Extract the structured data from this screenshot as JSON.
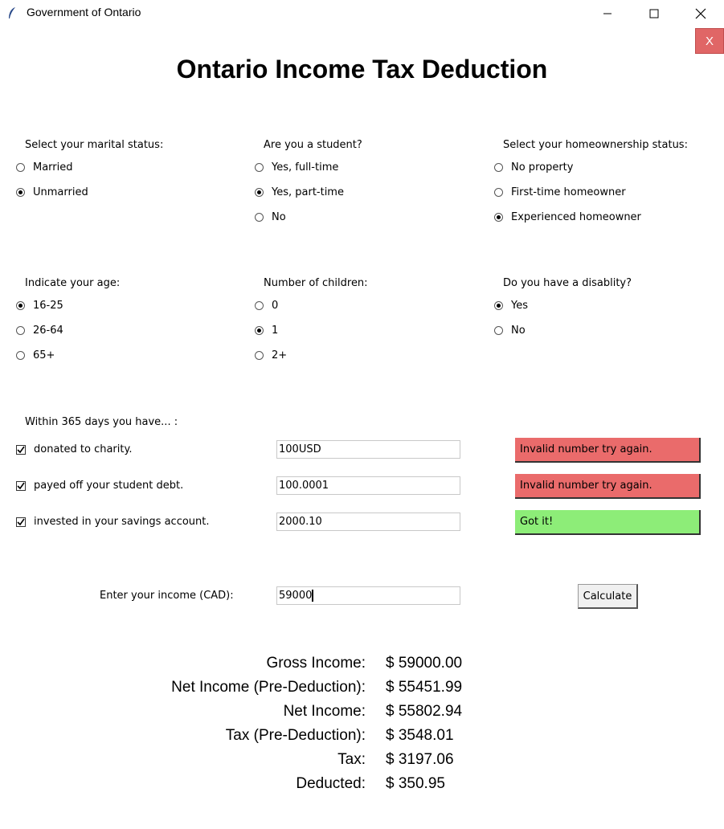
{
  "window": {
    "title": "Government of Ontario"
  },
  "close_button": "X",
  "main_title": "Ontario Income Tax Deduction",
  "marital": {
    "label": "Select your marital status:",
    "options": [
      "Married",
      "Unmarried"
    ],
    "selected": 1
  },
  "student": {
    "label": "Are you a student?",
    "options": [
      "Yes, full-time",
      "Yes, part-time",
      "No"
    ],
    "selected": 1
  },
  "home": {
    "label": "Select your homeownership status:",
    "options": [
      "No property",
      "First-time homeowner",
      "Experienced homeowner"
    ],
    "selected": 2
  },
  "age": {
    "label": "Indicate your age:",
    "options": [
      "16-25",
      "26-64",
      "65+"
    ],
    "selected": 0
  },
  "children": {
    "label": "Number of children:",
    "options": [
      "0",
      "1",
      "2+"
    ],
    "selected": 1
  },
  "disability": {
    "label": "Do you have a disablity?",
    "options": [
      "Yes",
      "No"
    ],
    "selected": 0
  },
  "within": {
    "label": "Within 365 days you have... :",
    "items": [
      {
        "label": "donated to charity.",
        "checked": true,
        "value": "100USD",
        "status": "Invalid number try again."
      },
      {
        "label": "payed off your student debt.",
        "checked": true,
        "value": "100.0001",
        "status": "Invalid number try again."
      },
      {
        "label": "invested in your savings account.",
        "checked": true,
        "value": "2000.10",
        "status": "Got it!"
      }
    ]
  },
  "income": {
    "label": "Enter your income (CAD):",
    "value": "59000"
  },
  "calculate_label": "Calculate",
  "results": [
    {
      "label": "Gross Income:",
      "value": "$ 59000.00"
    },
    {
      "label": "Net Income (Pre-Deduction):",
      "value": "$ 55451.99"
    },
    {
      "label": "Net Income:",
      "value": "$ 55802.94"
    },
    {
      "label": "Tax (Pre-Deduction):",
      "value": "$ 3548.01"
    },
    {
      "label": "Tax:",
      "value": "$ 3197.06"
    },
    {
      "label": "Deducted:",
      "value": "$ 350.95"
    }
  ],
  "colors": {
    "invalid": "#ea6b6b",
    "valid": "#8ded78",
    "close": "#e06666"
  }
}
